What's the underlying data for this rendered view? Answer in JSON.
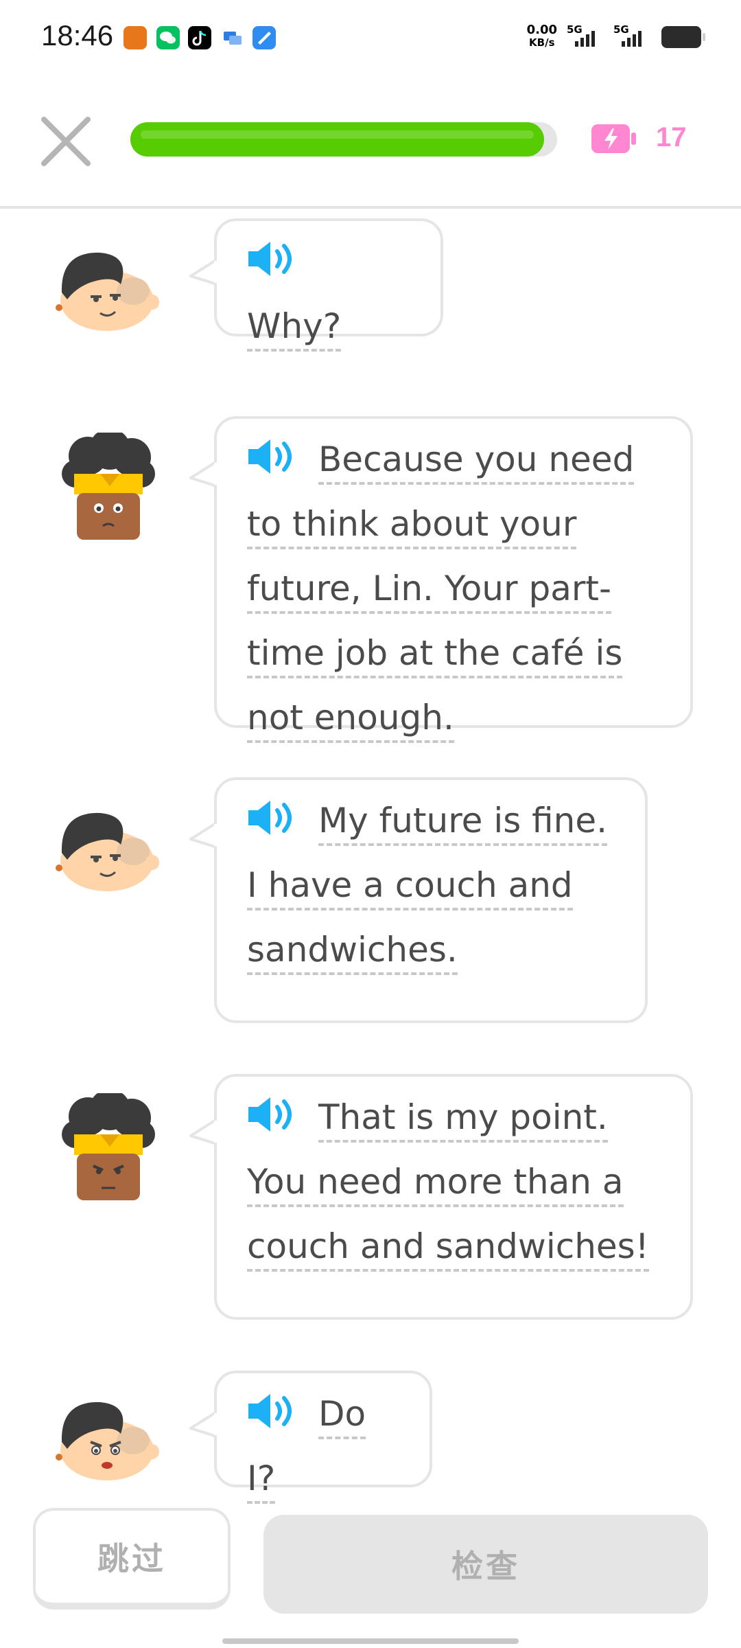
{
  "status_bar": {
    "time": "18:46",
    "net_speed_value": "0.00",
    "net_speed_unit": "KB/s",
    "signal1_label": "5G",
    "signal2_label": "5G",
    "app_icons": [
      "tomcat-app-icon",
      "wechat-icon",
      "tiktok-icon",
      "messages-icon",
      "browser-icon"
    ]
  },
  "lesson": {
    "progress_percent": 97,
    "energy_count": "17",
    "energy_color": "#ff86d0",
    "progress_color": "#58cc02"
  },
  "messages": [
    {
      "speaker": "Lin",
      "text": "Why?"
    },
    {
      "speaker": "Friend",
      "text": "Because you need to think about your future, Lin. Your part-time job at the café is not enough."
    },
    {
      "speaker": "Lin",
      "text": "My future is fine. I have a couch and sandwiches."
    },
    {
      "speaker": "Friend",
      "text": "That is my point. You need more than a couch and sandwiches!"
    },
    {
      "speaker": "Lin",
      "text": "Do I?"
    }
  ],
  "buttons": {
    "skip_label": "跳过",
    "check_label": "检查"
  }
}
